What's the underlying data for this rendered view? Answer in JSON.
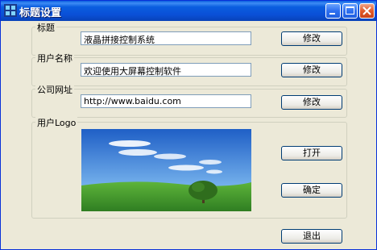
{
  "window": {
    "title": "标题设置"
  },
  "groups": {
    "title": {
      "label": "标题",
      "value": "液晶拼接控制系统",
      "button": "修改"
    },
    "user": {
      "label": "用户名称",
      "value": "欢迎使用大屏幕控制软件",
      "button": "修改"
    },
    "url": {
      "label": "公司网址",
      "value": "http://www.baidu.com",
      "button": "修改"
    },
    "logo": {
      "label": "用户Logo",
      "open_button": "打开",
      "ok_button": "确定"
    }
  },
  "exit_button": "退出",
  "colors": {
    "titlebar": "#0a5ee0",
    "background": "#ece9d8",
    "sky": "#2a6fd0",
    "grass": "#3f9a2f"
  }
}
